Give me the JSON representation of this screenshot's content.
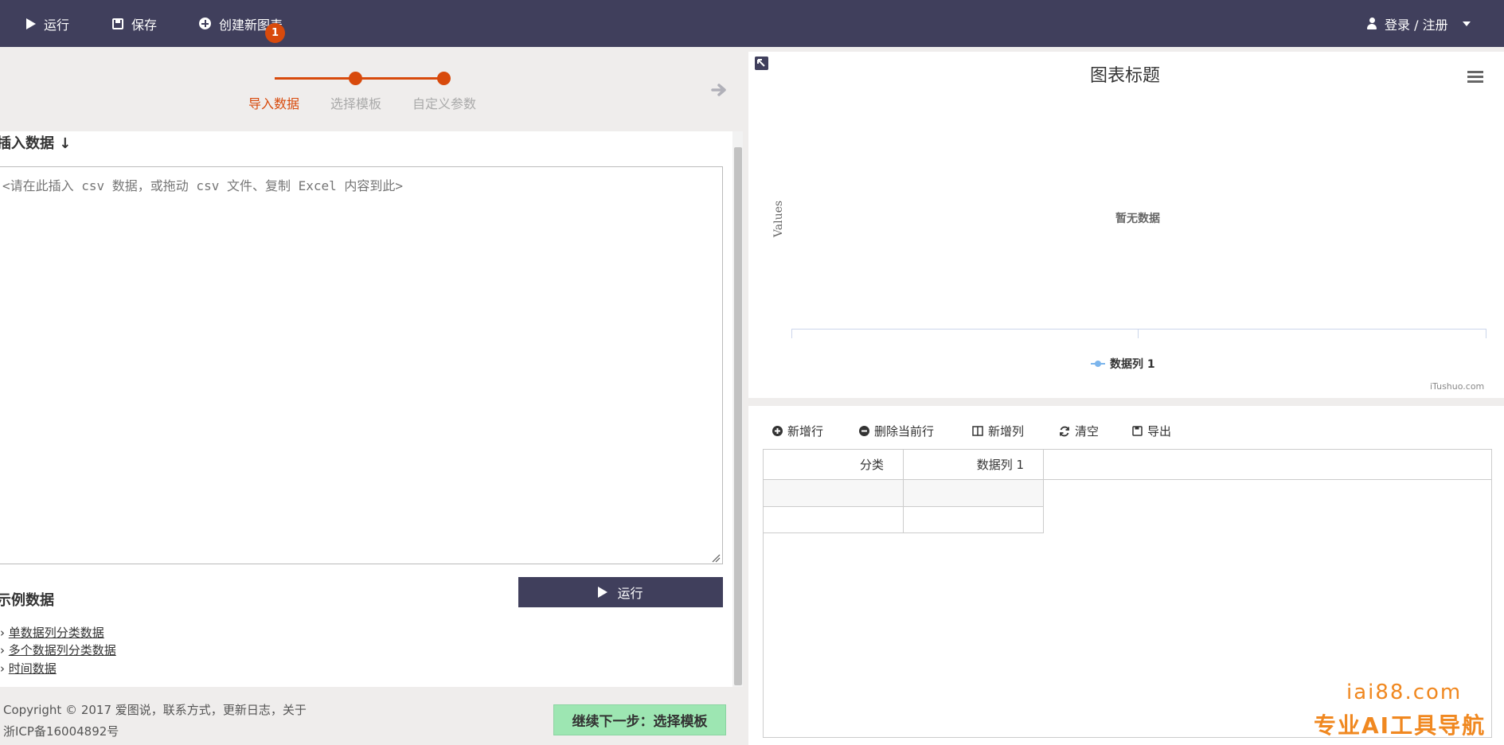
{
  "topbar": {
    "run_label": "运行",
    "save_label": "保存",
    "create_label": "创建新图表",
    "login_label": "登录 / 注册"
  },
  "stepper": {
    "current_step": "1",
    "steps": [
      "导入数据",
      "选择模板",
      "自定义参数"
    ]
  },
  "import": {
    "heading": "插入数据 ↓",
    "placeholder": "<请在此插入 csv 数据，或拖动 csv 文件、复制 Excel 内容到此>",
    "run_label": "运行"
  },
  "samples": {
    "heading": "示例数据",
    "items": [
      "单数据列分类数据",
      "多个数据列分类数据",
      "时间数据"
    ]
  },
  "footer": {
    "copyright": "Copyright © 2017 爱图说，",
    "links": [
      "联系方式",
      "更新日志",
      "关于"
    ],
    "icp": "浙ICP备16004892号",
    "next_label": "继续下一步：选择模板"
  },
  "chart": {
    "title": "图表标题",
    "ylabel": "Values",
    "no_data": "暂无数据",
    "legend": "数据列 1",
    "credits": "iTushuo.com",
    "series_color": "#7cb5ec"
  },
  "chart_data": {
    "type": "line",
    "title": "图表标题",
    "ylabel": "Values",
    "xlabel": "",
    "series": [
      {
        "name": "数据列 1",
        "values": []
      }
    ],
    "categories": [],
    "legend_position": "bottom-center",
    "grid": false
  },
  "table_toolbar": {
    "add_row": "新增行",
    "delete_row": "删除当前行",
    "add_col": "新增列",
    "clear": "清空",
    "export": "导出"
  },
  "table": {
    "headers": [
      "分类",
      "数据列 1"
    ]
  },
  "watermark": {
    "line1": "iai88.com",
    "line2": "专业AI工具导航"
  },
  "colors": {
    "topbar": "#403f5c",
    "accent": "#d84a0c",
    "next_button": "#9de6b2",
    "watermark": "#f08820"
  }
}
